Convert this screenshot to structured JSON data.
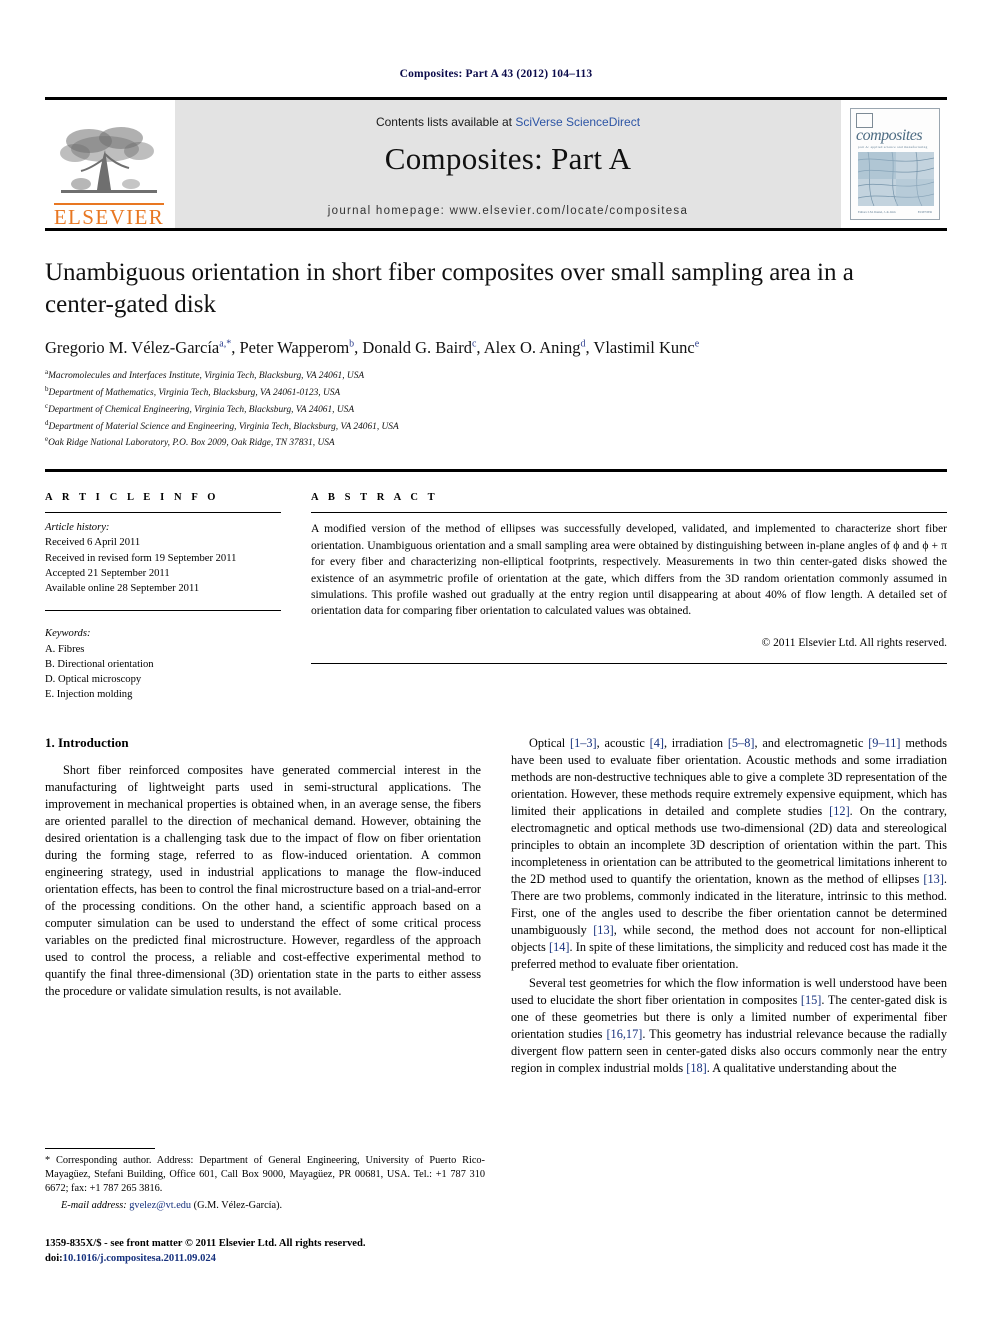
{
  "running_head": "Composites: Part A 43 (2012) 104–113",
  "masthead": {
    "publisher_name": "ELSEVIER",
    "contents_prefix": "Contents lists available at ",
    "contents_link": "SciVerse ScienceDirect",
    "journal_title": "Composites: Part A",
    "homepage": "journal homepage: www.elsevier.com/locate/compositesa",
    "cover": {
      "word": "composites",
      "subtitle": "part A: applied science and manufacturing",
      "foot_left": "Editors: I.M. Daniel, J.-K. Kim",
      "foot_right": "ELSEVIER"
    },
    "link_color": "#2d55a5",
    "brand_color": "#E87722"
  },
  "article": {
    "title": "Unambiguous orientation in short fiber composites over small sampling area in a center-gated disk",
    "authors": [
      {
        "name": "Gregorio M. Vélez-García",
        "marks": "a,*"
      },
      {
        "name": "Peter Wapperom",
        "marks": "b"
      },
      {
        "name": "Donald G. Baird",
        "marks": "c"
      },
      {
        "name": "Alex O. Aning",
        "marks": "d"
      },
      {
        "name": "Vlastimil Kunc",
        "marks": "e"
      }
    ],
    "affiliations": [
      {
        "mark": "a",
        "text": "Macromolecules and Interfaces Institute, Virginia Tech, Blacksburg, VA 24061, USA"
      },
      {
        "mark": "b",
        "text": "Department of Mathematics, Virginia Tech, Blacksburg, VA 24061-0123, USA"
      },
      {
        "mark": "c",
        "text": "Department of Chemical Engineering, Virginia Tech, Blacksburg, VA 24061, USA"
      },
      {
        "mark": "d",
        "text": "Department of Material Science and Engineering, Virginia Tech, Blacksburg, VA 24061, USA"
      },
      {
        "mark": "e",
        "text": "Oak Ridge National Laboratory, P.O. Box 2009, Oak Ridge, TN 37831, USA"
      }
    ]
  },
  "article_info": {
    "heading": "A R T I C L E   I N F O",
    "history_label": "Article history:",
    "history": [
      "Received 6 April 2011",
      "Received in revised form 19 September 2011",
      "Accepted 21 September 2011",
      "Available online 28 September 2011"
    ],
    "keywords_label": "Keywords:",
    "keywords": [
      "A. Fibres",
      "B. Directional orientation",
      "D. Optical microscopy",
      "E. Injection molding"
    ]
  },
  "abstract": {
    "heading": "A B S T R A C T",
    "text": "A modified version of the method of ellipses was successfully developed, validated, and implemented to characterize short fiber orientation. Unambiguous orientation and a small sampling area were obtained by distinguishing between in-plane angles of ϕ and ϕ + π for every fiber and characterizing non-elliptical footprints, respectively. Measurements in two thin center-gated disks showed the existence of an asymmetric profile of orientation at the gate, which differs from the 3D random orientation commonly assumed in simulations. This profile washed out gradually at the entry region until disappearing at about 40% of flow length. A detailed set of orientation data for comparing fiber orientation to calculated values was obtained.",
    "copyright": "© 2011 Elsevier Ltd. All rights reserved."
  },
  "body": {
    "section_number_title": "1. Introduction",
    "left_paragraphs": [
      "Short fiber reinforced composites have generated commercial interest in the manufacturing of lightweight parts used in semi-structural applications. The improvement in mechanical properties is obtained when, in an average sense, the fibers are oriented parallel to the direction of mechanical demand. However, obtaining the desired orientation is a challenging task due to the impact of flow on fiber orientation during the forming stage, referred to as flow-induced orientation. A common engineering strategy, used in industrial applications to manage the flow-induced orientation effects, has been to control the final microstructure based on a trial-and-error of the processing conditions. On the other hand, a scientific approach based on a computer simulation can be used to understand the effect of some critical process variables on the predicted final microstructure. However, regardless of the approach used to control the process, a reliable and cost-effective experimental method to quantify the final three-dimensional (3D) orientation state in the parts to either assess the procedure or validate simulation results, is not available."
    ],
    "right_paragraph_1_parts": [
      {
        "t": "Optical ",
        "r": false
      },
      {
        "t": "[1–3]",
        "r": true
      },
      {
        "t": ", acoustic ",
        "r": false
      },
      {
        "t": "[4]",
        "r": true
      },
      {
        "t": ", irradiation ",
        "r": false
      },
      {
        "t": "[5–8]",
        "r": true
      },
      {
        "t": ", and electromagnetic ",
        "r": false
      },
      {
        "t": "[9–11]",
        "r": true
      },
      {
        "t": " methods have been used to evaluate fiber orientation. Acoustic methods and some irradiation methods are non-destructive techniques able to give a complete 3D representation of the orientation. However, these methods require extremely expensive equipment, which has limited their applications in detailed and complete studies ",
        "r": false
      },
      {
        "t": "[12]",
        "r": true
      },
      {
        "t": ". On the contrary, electromagnetic and optical methods use two-dimensional (2D) data and stereological principles to obtain an incomplete 3D description of orientation within the part. This incompleteness in orientation can be attributed to the geometrical limitations inherent to the 2D method used to quantify the orientation, known as the method of ellipses ",
        "r": false
      },
      {
        "t": "[13]",
        "r": true
      },
      {
        "t": ". There are two problems, commonly indicated in the literature, intrinsic to this method. First, one of the angles used to describe the fiber orientation cannot be determined unambiguously ",
        "r": false
      },
      {
        "t": "[13]",
        "r": true
      },
      {
        "t": ", while second, the method does not account for non-elliptical objects ",
        "r": false
      },
      {
        "t": "[14]",
        "r": true
      },
      {
        "t": ". In spite of these limitations, the simplicity and reduced cost has made it the preferred method to evaluate fiber orientation.",
        "r": false
      }
    ],
    "right_paragraph_2_parts": [
      {
        "t": "Several test geometries for which the flow information is well understood have been used to elucidate the short fiber orientation in composites ",
        "r": false
      },
      {
        "t": "[15]",
        "r": true
      },
      {
        "t": ". The center-gated disk is one of these geometries but there is only a limited number of experimental fiber orientation studies ",
        "r": false
      },
      {
        "t": "[16,17]",
        "r": true
      },
      {
        "t": ". This geometry has industrial relevance because the radially divergent flow pattern seen in center-gated disks also occurs commonly near the entry region in complex industrial molds ",
        "r": false
      },
      {
        "t": "[18]",
        "r": true
      },
      {
        "t": ". A qualitative understanding about the",
        "r": false
      }
    ]
  },
  "footnotes": {
    "corresponding": "* Corresponding author. Address: Department of General Engineering, University of Puerto Rico-Mayagüez, Stefani Building, Office 601, Call Box 9000, Mayagüez, PR 00681, USA. Tel.: +1 787 310 6672; fax: +1 787 265 3816.",
    "email_label": "E-mail address:",
    "email": "gvelez@vt.edu",
    "email_owner": "(G.M. Vélez-García).",
    "issn_line": "1359-835X/$ - see front matter © 2011 Elsevier Ltd. All rights reserved.",
    "doi_label": "doi:",
    "doi_value": "10.1016/j.compositesa.2011.09.024"
  }
}
